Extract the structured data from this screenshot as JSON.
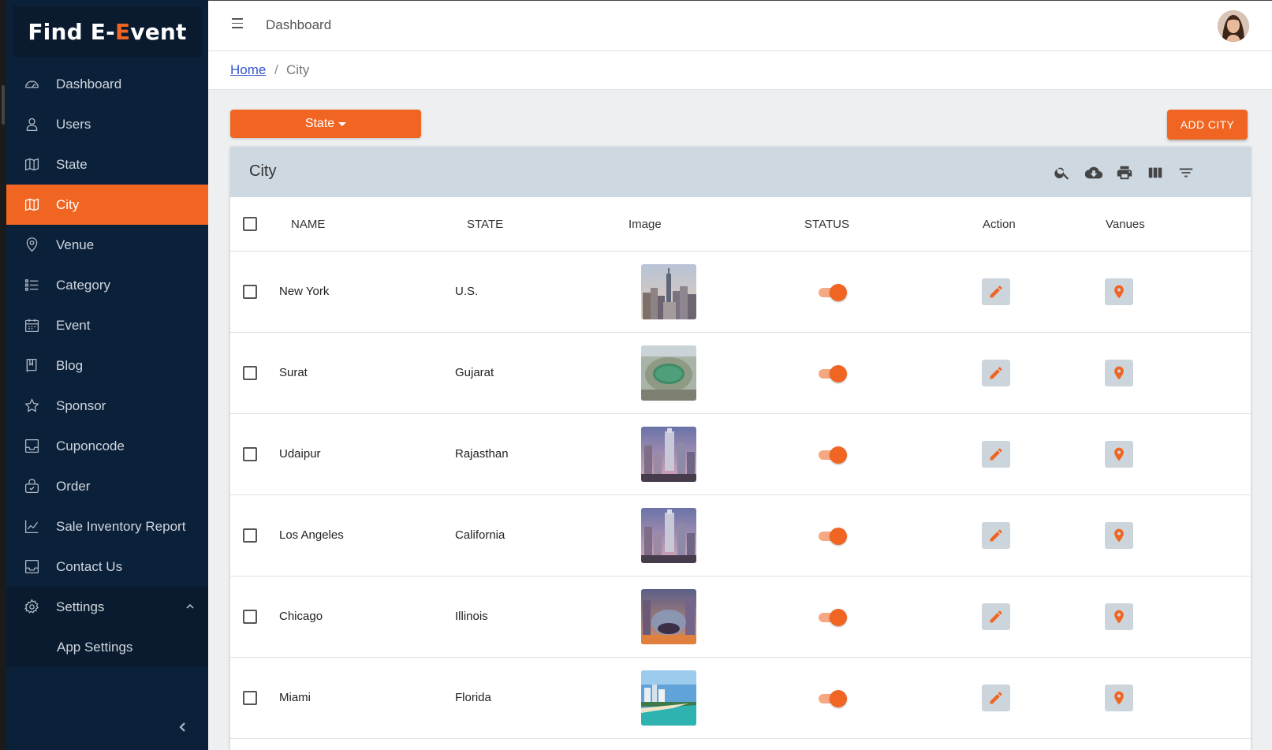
{
  "brand": {
    "prefix": "Find E-",
    "accent": "E",
    "suffix": "vent"
  },
  "sidebar": {
    "items": [
      {
        "label": "Dashboard",
        "icon": "dashboard-icon"
      },
      {
        "label": "Users",
        "icon": "user-icon"
      },
      {
        "label": "State",
        "icon": "map-icon"
      },
      {
        "label": "City",
        "icon": "map-icon",
        "active": true
      },
      {
        "label": "Venue",
        "icon": "location-pin-icon"
      },
      {
        "label": "Category",
        "icon": "list-icon"
      },
      {
        "label": "Event",
        "icon": "calendar-icon"
      },
      {
        "label": "Blog",
        "icon": "book-icon"
      },
      {
        "label": "Sponsor",
        "icon": "star-icon"
      },
      {
        "label": "Cuponcode",
        "icon": "inbox-icon"
      },
      {
        "label": "Order",
        "icon": "shopping-bag-icon"
      },
      {
        "label": "Sale Inventory Report",
        "icon": "chart-icon"
      },
      {
        "label": "Contact Us",
        "icon": "inbox-icon"
      },
      {
        "label": "Settings",
        "icon": "gear-icon"
      }
    ],
    "settings_sub": {
      "label": "App Settings"
    }
  },
  "topbar": {
    "title": "Dashboard"
  },
  "breadcrumb": {
    "home": "Home",
    "separator": "/",
    "current": "City"
  },
  "toolbar": {
    "state_label": "State",
    "add_label": "ADD CITY"
  },
  "table": {
    "title": "City",
    "columns": {
      "name": "NAME",
      "state": "STATE",
      "image": "Image",
      "status": "STATUS",
      "action": "Action",
      "venues": "Vanues"
    },
    "rows": [
      {
        "name": "New York",
        "state": "U.S.",
        "status_on": true
      },
      {
        "name": "Surat",
        "state": "Gujarat",
        "status_on": true
      },
      {
        "name": "Udaipur",
        "state": "Rajasthan",
        "status_on": true
      },
      {
        "name": "Los Angeles",
        "state": "California",
        "status_on": true
      },
      {
        "name": "Chicago",
        "state": "Illinois",
        "status_on": true
      },
      {
        "name": "Miami",
        "state": "Florida",
        "status_on": true
      }
    ]
  },
  "colors": {
    "accent": "#f06522",
    "sidebar_bg": "#0b2039",
    "table_head_bg": "#cdd8e1"
  }
}
